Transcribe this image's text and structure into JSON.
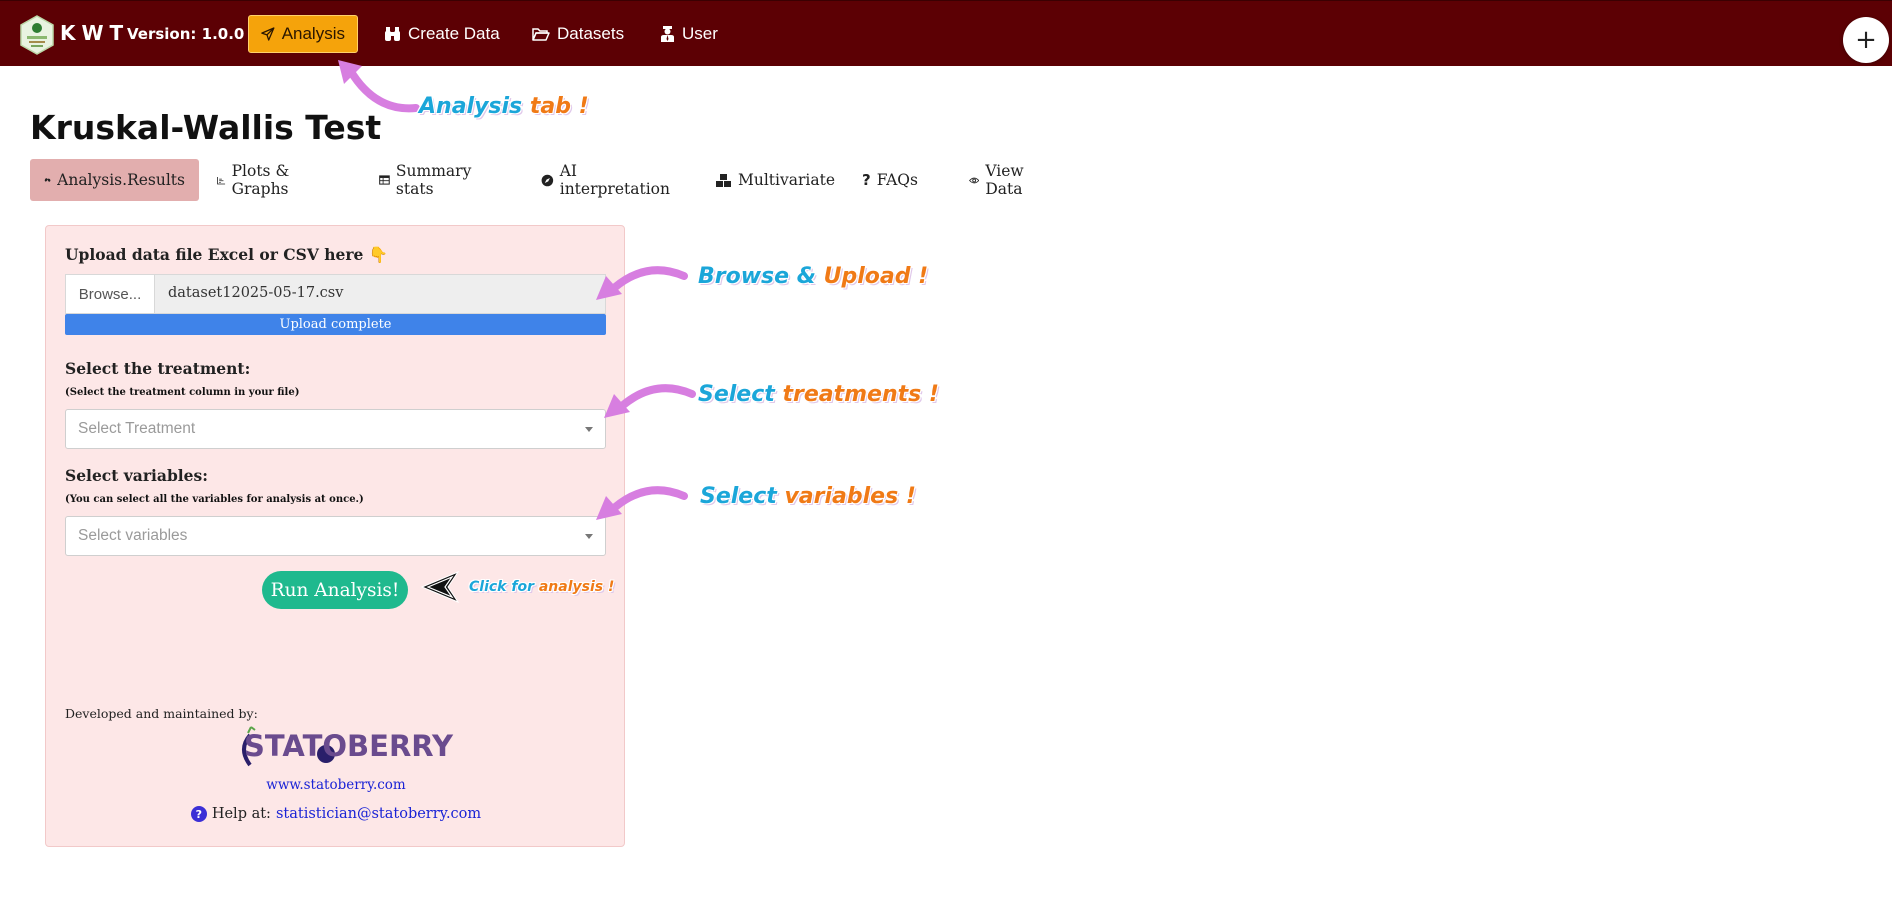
{
  "navbar": {
    "brand": "KWT",
    "version": "Version: 1.0.0",
    "items": [
      {
        "label": "Analysis",
        "icon": "paper-plane-icon",
        "active": true
      },
      {
        "label": "Create Data",
        "icon": "binoculars-icon",
        "active": false
      },
      {
        "label": "Datasets",
        "icon": "folder-open-icon",
        "active": false
      },
      {
        "label": "User",
        "icon": "user-tie-icon",
        "active": false
      }
    ],
    "plus": "+"
  },
  "page": {
    "title": "Kruskal-Wallis Test",
    "tabs": [
      {
        "label": "Analysis.Results",
        "icon": "hands-icon",
        "active": true
      },
      {
        "label": "Plots & Graphs",
        "icon": "chart-icon",
        "active": false
      },
      {
        "label": "Summary stats",
        "icon": "table-icon",
        "active": false
      },
      {
        "label": "AI interpretation",
        "icon": "compass-icon",
        "active": false
      },
      {
        "label": "Multivariate",
        "icon": "cubes-icon",
        "active": false
      },
      {
        "label": "FAQs",
        "icon": "question-icon",
        "active": false
      },
      {
        "label": "View Data",
        "icon": "eye-icon",
        "active": false
      }
    ]
  },
  "panel": {
    "upload_label": "Upload data file Excel or CSV here 👇",
    "browse_label": "Browse...",
    "file_name": "dataset12025-05-17.csv",
    "progress_text": "Upload complete",
    "progress_fraction": 1.0,
    "treatment_label": "Select the treatment:",
    "treatment_sublabel": "(Select the treatment column in your file)",
    "treatment_placeholder": "Select Treatment",
    "variables_label": "Select variables:",
    "variables_sublabel": "(You can select all the variables for analysis at once.)",
    "variables_placeholder": "Select variables",
    "run_button": "Run Analysis!",
    "developed_by": "Developed and maintained by:",
    "logo_text": "STATOBERRY",
    "website": "www.statoberry.com",
    "help_prefix": "Help at:",
    "help_email": "statistician@statoberry.com"
  },
  "annotations": {
    "analysis_tab": {
      "word1": "Analysis",
      "word2": "tab !"
    },
    "browse": {
      "word1": "Browse &",
      "word2": "Upload !"
    },
    "treatments": {
      "word1": "Select",
      "word2": "treatments !"
    },
    "variables": {
      "word1": "Select",
      "word2": "variables !"
    },
    "click": {
      "word1": "Click for",
      "word2": "analysis !"
    }
  },
  "colors": {
    "navbar_bg": "#5c0004",
    "nav_active_bg": "#f5a30b",
    "tab_active_bg": "#e2aeae",
    "panel_bg": "#fde7e7",
    "progress_fill": "#3f83e9",
    "run_button_bg": "#1fb98e",
    "annotation_blue": "#1ba6d9",
    "annotation_orange": "#f07a16",
    "annotation_arrow": "#d77ee0"
  }
}
